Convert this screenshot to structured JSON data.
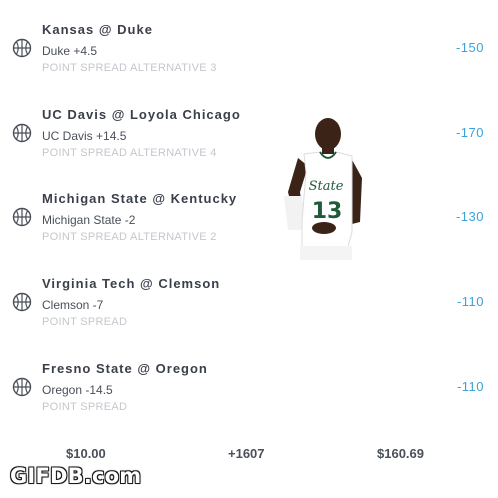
{
  "bets": [
    {
      "matchup": "Kansas @ Duke",
      "pick": "Duke +4.5",
      "market": "POINT SPREAD ALTERNATIVE 3",
      "odds": "-150",
      "icon": "basketball-icon"
    },
    {
      "matchup": "UC Davis @ Loyola Chicago",
      "pick": "UC Davis +14.5",
      "market": "POINT SPREAD ALTERNATIVE 4",
      "odds": "-170",
      "icon": "basketball-icon"
    },
    {
      "matchup": "Michigan State @ Kentucky",
      "pick": "Michigan State -2",
      "market": "POINT SPREAD ALTERNATIVE 2",
      "odds": "-130",
      "icon": "basketball-icon"
    },
    {
      "matchup": "Virginia Tech @ Clemson",
      "pick": "Clemson -7",
      "market": "POINT SPREAD",
      "odds": "-110",
      "icon": "basketball-icon"
    },
    {
      "matchup": "Fresno State @ Oregon",
      "pick": "Oregon -14.5",
      "market": "POINT SPREAD",
      "odds": "-110",
      "icon": "basketball-icon"
    }
  ],
  "summary": {
    "wager": "$10.00",
    "odds": "+1607",
    "payout": "$160.69"
  },
  "player": {
    "jersey_text": "State",
    "jersey_number": "13"
  },
  "watermark": "GIFDB.com",
  "colors": {
    "odds": "#3aa2dc",
    "text": "#3a3f4a",
    "muted": "#c4c7cc",
    "jersey": "#ffffff",
    "skin": "#3b2417"
  }
}
